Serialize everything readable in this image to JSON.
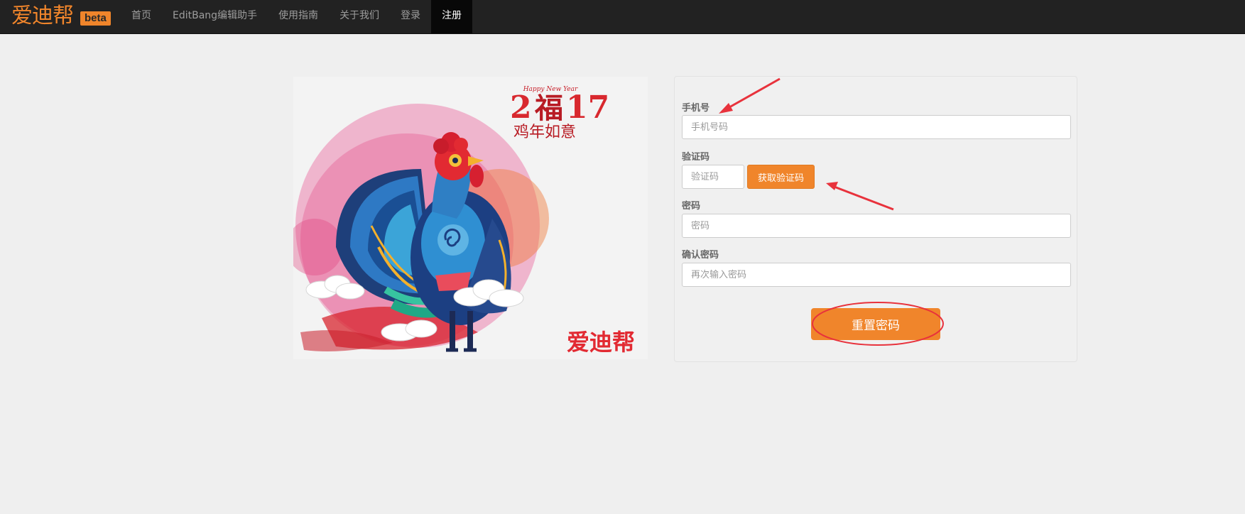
{
  "brand": {
    "name": "爱迪帮",
    "badge": "beta",
    "color": "#f0852b"
  },
  "nav": {
    "items": [
      {
        "label": "首页",
        "active": false
      },
      {
        "label": "EditBang编辑助手",
        "active": false
      },
      {
        "label": "使用指南",
        "active": false
      },
      {
        "label": "关于我们",
        "active": false
      },
      {
        "label": "登录",
        "active": false
      },
      {
        "label": "注册",
        "active": true
      }
    ]
  },
  "banner": {
    "happy_new_year": "Happy New Year",
    "year_left": "2",
    "fu": "福",
    "year_right": "17",
    "slogan": "鸡年如意",
    "logo": "爱迪帮"
  },
  "form": {
    "phone": {
      "label": "手机号",
      "placeholder": "手机号码",
      "value": ""
    },
    "code": {
      "label": "验证码",
      "placeholder": "验证码",
      "value": "",
      "button": "获取验证码"
    },
    "password": {
      "label": "密码",
      "placeholder": "密码",
      "value": ""
    },
    "confirm": {
      "label": "确认密码",
      "placeholder": "再次输入密码",
      "value": ""
    },
    "submit": "重置密码"
  },
  "colors": {
    "accent": "#f0852b",
    "annotation": "#e8323c",
    "navbar": "#222222"
  }
}
